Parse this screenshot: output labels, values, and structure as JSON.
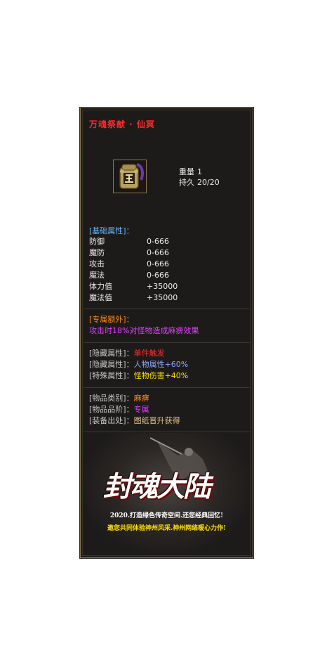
{
  "item": {
    "name": "万魂祭献 · 仙冥",
    "icon": "seal-token-icon",
    "weight_label": "重量",
    "weight_value": "1",
    "durability_label": "持久",
    "durability_value": "20/20"
  },
  "base": {
    "header": "[基础属性]：",
    "stats": [
      {
        "label": "防御",
        "value": "0-666"
      },
      {
        "label": "魔防",
        "value": "0-666"
      },
      {
        "label": "攻击",
        "value": "0-666"
      },
      {
        "label": "魔法",
        "value": "0-666"
      },
      {
        "label": "体力值",
        "value": "+35000"
      },
      {
        "label": "魔法值",
        "value": "+35000"
      }
    ]
  },
  "extra": {
    "header": "[专属额外]：",
    "effect": "攻击时18%对怪物造成麻痹效果"
  },
  "hidden": [
    {
      "label": "[隐藏属性]：",
      "value": "单件触发",
      "suffix": ""
    },
    {
      "label": "[隐藏属性]：",
      "value": "人物属性",
      "suffix": "+60%"
    },
    {
      "label": "[特殊属性]：",
      "value": "怪物伤害",
      "suffix": "+40%"
    }
  ],
  "info": [
    {
      "label": "[物品类别]：",
      "value": "麻痹"
    },
    {
      "label": "[物品品阶]：",
      "value": "专属"
    },
    {
      "label": "[装备出处]：",
      "value": "图纸晋升获得"
    }
  ],
  "banner": {
    "logo": "封魂大陆",
    "slogan1": "2020.打造绿色传奇空间.还您经典回忆!",
    "slogan2": "邀您共同体验神州风采.神州网络暖心力作!"
  },
  "colors": {
    "title": "#ff2a2a",
    "border": "#8a7a52",
    "background": "#1d1b1a"
  }
}
